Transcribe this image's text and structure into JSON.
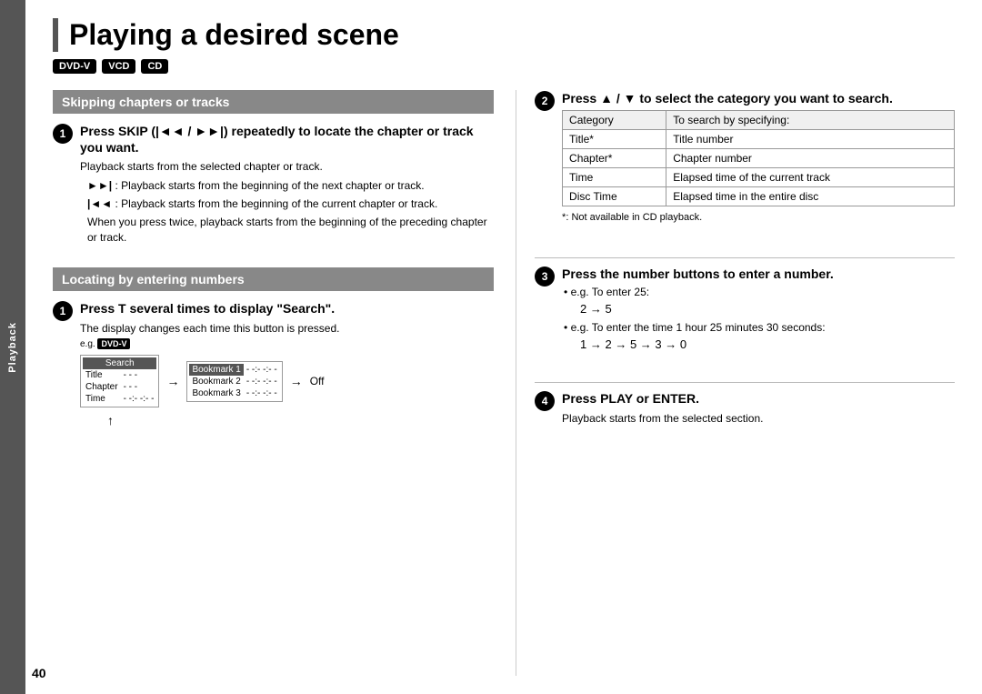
{
  "page": {
    "number": "40",
    "sidebar_label": "Playback"
  },
  "title": "Playing a desired scene",
  "badges": [
    "DVD-V",
    "VCD",
    "CD"
  ],
  "left_column": {
    "section1": {
      "header": "Skipping chapters or tracks",
      "step": {
        "number": "1",
        "title": "Press SKIP (|◄◄ / ►►|) repeatedly to locate the chapter or track you want.",
        "desc": "Playback starts from the selected chapter or track.",
        "sub1_icon": "►►|",
        "sub1_text": ": Playback starts from the beginning of the next chapter or track.",
        "sub2_icon": "|◄◄",
        "sub2_text": ": Playback starts from the beginning of the current chapter or track.",
        "sub3_text": "When you press twice, playback starts from the beginning of the preceding chapter or track."
      }
    },
    "section2": {
      "header": "Locating by entering numbers",
      "step": {
        "number": "1",
        "title": "Press T several times to display \"Search\".",
        "desc": "The display changes each time this button is pressed.",
        "example_label": "e.g.",
        "example_badge": "DVD-V",
        "search_box": {
          "header": "Search",
          "rows": [
            {
              "label": "Title",
              "value": "- - -"
            },
            {
              "label": "Chapter",
              "value": "- - -"
            },
            {
              "label": "Time",
              "value": "- -:- -:- -"
            }
          ]
        },
        "bookmark_box": {
          "rows": [
            {
              "label": "Bookmark 1",
              "value": "- -:- -:- -"
            },
            {
              "label": "Bookmark 2",
              "value": "- -:- -:- -"
            },
            {
              "label": "Bookmark 3",
              "value": "- -:- -:- -"
            }
          ]
        },
        "arrow_label": "Off"
      }
    }
  },
  "right_column": {
    "step2": {
      "number": "2",
      "title": "Press ▲ / ▼ to select the category you want to search.",
      "table": {
        "header_col1": "Category",
        "header_col2": "To search by specifying:",
        "rows": [
          {
            "col1": "Title*",
            "col2": "Title number"
          },
          {
            "col1": "Chapter*",
            "col2": "Chapter number"
          },
          {
            "col1": "Time",
            "col2": "Elapsed time of the current track"
          },
          {
            "col1": "Disc Time",
            "col2": "Elapsed time in the entire disc"
          }
        ]
      },
      "note": "*: Not available in CD playback."
    },
    "step3": {
      "number": "3",
      "title": "Press the number buttons to enter a number.",
      "bullet1": "e.g. To enter 25:",
      "formula1": "2 → 5",
      "bullet2": "e.g. To enter the time 1 hour 25 minutes 30 seconds:",
      "formula2": "1 → 2 → 5 → 3 → 0"
    },
    "step4": {
      "number": "4",
      "title": "Press PLAY or ENTER.",
      "desc": "Playback starts from the selected section."
    }
  }
}
